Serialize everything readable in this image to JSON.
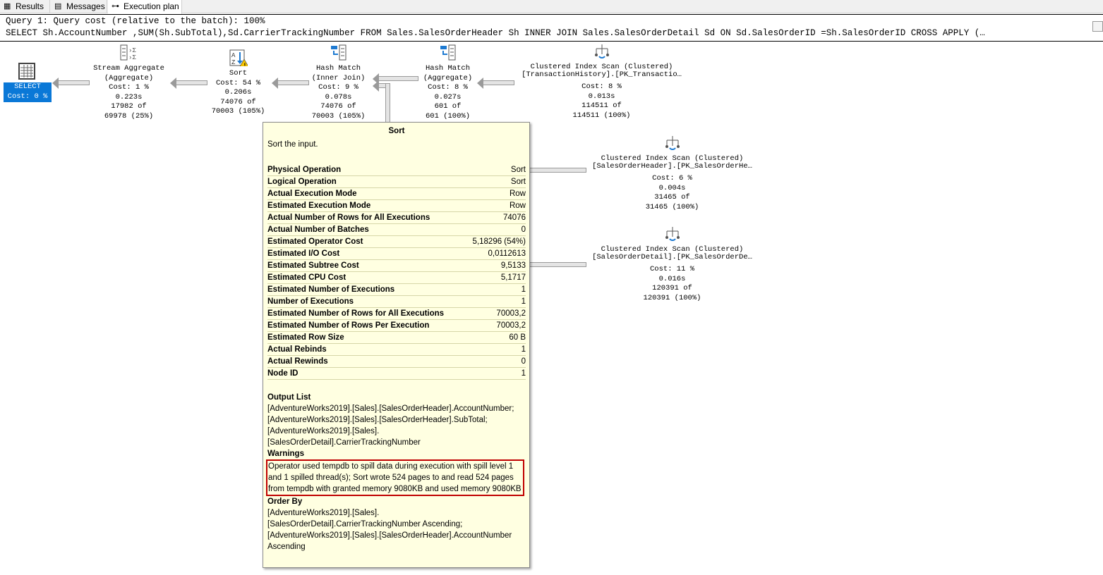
{
  "tabs": [
    {
      "label": "Results",
      "icon": "grid-icon"
    },
    {
      "label": "Messages",
      "icon": "messages-icon"
    },
    {
      "label": "Execution plan",
      "icon": "plan-icon"
    }
  ],
  "header": {
    "line1": "Query 1: Query cost (relative to the batch): 100%",
    "line2": "SELECT Sh.AccountNumber ,SUM(Sh.SubTotal),Sd.CarrierTrackingNumber FROM Sales.SalesOrderHeader Sh INNER JOIN Sales.SalesOrderDetail Sd ON Sd.SalesOrderID =Sh.SalesOrderID CROSS APPLY (…"
  },
  "select": {
    "label": "SELECT",
    "cost": "Cost: 0 %"
  },
  "nodes": [
    {
      "lines": [
        "Stream Aggregate",
        "(Aggregate)",
        "Cost: 1 %",
        "0.223s",
        "17982 of",
        "69978 (25%)"
      ]
    },
    {
      "lines": [
        "Sort",
        "Cost: 54 %",
        "0.206s",
        "74076 of",
        "70003 (105%)"
      ]
    },
    {
      "lines": [
        "Hash Match",
        "(Inner Join)",
        "Cost: 9 %",
        "0.078s",
        "74076 of",
        "70003 (105%)"
      ]
    },
    {
      "lines": [
        "Hash Match",
        "(Aggregate)",
        "Cost: 8 %",
        "0.027s",
        "601 of",
        "601 (100%)"
      ]
    },
    {
      "lines": [
        "Clustered Index Scan (Clustered)",
        "[TransactionHistory].[PK_Transactio…",
        "",
        "Cost: 8 %",
        "0.013s",
        "114511 of",
        "114511 (100%)"
      ]
    },
    {
      "lines": [
        "Clustered Index Scan (Clustered)",
        "[SalesOrderHeader].[PK_SalesOrderHe…",
        "",
        "Cost: 6 %",
        "0.004s",
        "31465 of",
        "31465 (100%)"
      ]
    },
    {
      "lines": [
        "Clustered Index Scan (Clustered)",
        "[SalesOrderDetail].[PK_SalesOrderDe…",
        "",
        "Cost: 11 %",
        "0.016s",
        "120391 of",
        "120391 (100%)"
      ]
    }
  ],
  "tooltip": {
    "title": "Sort",
    "description": "Sort the input.",
    "rows": [
      [
        "Physical Operation",
        "Sort"
      ],
      [
        "Logical Operation",
        "Sort"
      ],
      [
        "Actual Execution Mode",
        "Row"
      ],
      [
        "Estimated Execution Mode",
        "Row"
      ],
      [
        "Actual Number of Rows for All Executions",
        "74076"
      ],
      [
        "Actual Number of Batches",
        "0"
      ],
      [
        "Estimated Operator Cost",
        "5,18296 (54%)"
      ],
      [
        "Estimated I/O Cost",
        "0,0112613"
      ],
      [
        "Estimated Subtree Cost",
        "9,5133"
      ],
      [
        "Estimated CPU Cost",
        "5,1717"
      ],
      [
        "Estimated Number of Executions",
        "1"
      ],
      [
        "Number of Executions",
        "1"
      ],
      [
        "Estimated Number of Rows for All Executions",
        "70003,2"
      ],
      [
        "Estimated Number of Rows Per Execution",
        "70003,2"
      ],
      [
        "Estimated Row Size",
        "60 B"
      ],
      [
        "Actual Rebinds",
        "1"
      ],
      [
        "Actual Rewinds",
        "0"
      ],
      [
        "Node ID",
        "1"
      ]
    ],
    "output_list_label": "Output List",
    "output_list": "[AdventureWorks2019].[Sales].[SalesOrderHeader].AccountNumber; [AdventureWorks2019].[Sales].[SalesOrderHeader].SubTotal; [AdventureWorks2019].[Sales].[SalesOrderDetail].CarrierTrackingNumber",
    "warnings_label": "Warnings",
    "warnings": "Operator used tempdb to spill data during execution with spill level 1 and 1 spilled thread(s); Sort wrote 524 pages to and read 524 pages from tempdb with granted memory 9080KB and used memory 9080KB",
    "order_by_label": "Order By",
    "order_by": "[AdventureWorks2019].[Sales].[SalesOrderDetail].CarrierTrackingNumber Ascending; [AdventureWorks2019].[Sales].[SalesOrderHeader].AccountNumber Ascending"
  }
}
